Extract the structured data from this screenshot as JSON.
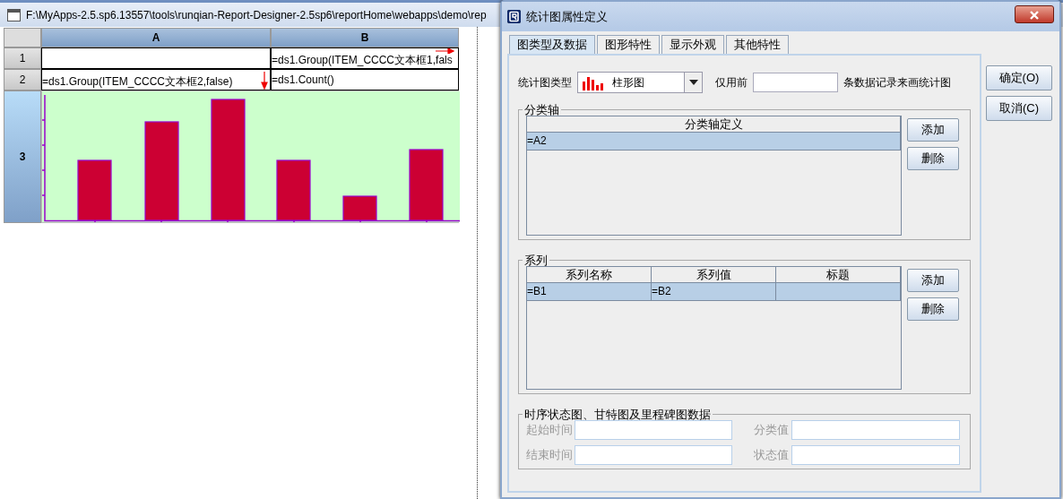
{
  "background_window": {
    "title": "F:\\MyApps-2.5.sp6.13557\\tools\\runqian-Report-Designer-2.5sp6\\reportHome\\webapps\\demo\\rep"
  },
  "sheet": {
    "columns": [
      "A",
      "B"
    ],
    "rows": [
      {
        "header": "1",
        "selected": false,
        "cells": [
          {},
          {
            "text": "=ds1.Group(ITEM_CCCC文本框1,fals",
            "kind": "expand-right"
          }
        ]
      },
      {
        "header": "2",
        "selected": false,
        "cells": [
          {
            "text": "=ds1.Group(ITEM_CCCC文本框2,false)",
            "kind": "expand-down"
          },
          {
            "text": "=ds1.Count()"
          }
        ]
      },
      {
        "header": "3",
        "selected": true,
        "kind": "chart"
      }
    ]
  },
  "dialog": {
    "title": "统计图属性定义",
    "tabs": [
      {
        "label": "图类型及数据",
        "selected": true
      },
      {
        "label": "图形特性",
        "selected": false
      },
      {
        "label": "显示外观",
        "selected": false
      },
      {
        "label": "其他特性",
        "selected": false
      }
    ],
    "buttons": [
      "确定(O)",
      "取消(C)"
    ],
    "chart_type": {
      "label": "统计图类型",
      "value": "柱形图"
    },
    "limit": {
      "label_before": "仅用前",
      "label_after": "条数据记录来画统计图"
    },
    "category_axis": {
      "title": "分类轴",
      "columns": [
        "分类轴定义"
      ],
      "rows": [
        {
          "selected": true,
          "cells": [
            "=A2"
          ]
        }
      ],
      "buttons": [
        "添加",
        "删除"
      ]
    },
    "series": {
      "title": "系列",
      "columns": [
        "系列名称",
        "系列值",
        "标题"
      ],
      "rows": [
        {
          "selected": true,
          "cells": [
            "=B1",
            "=B2"
          ]
        }
      ],
      "buttons": [
        "添加",
        "删除"
      ]
    },
    "timeline": {
      "title": "时序状态图、甘特图及里程碑图数据",
      "fields": [
        {
          "label": "起始时间",
          "disabled": true
        },
        {
          "label": "分类值",
          "disabled": true
        },
        {
          "label": "结束时间",
          "disabled": true
        },
        {
          "label": "状态值",
          "disabled": true
        }
      ]
    }
  }
}
